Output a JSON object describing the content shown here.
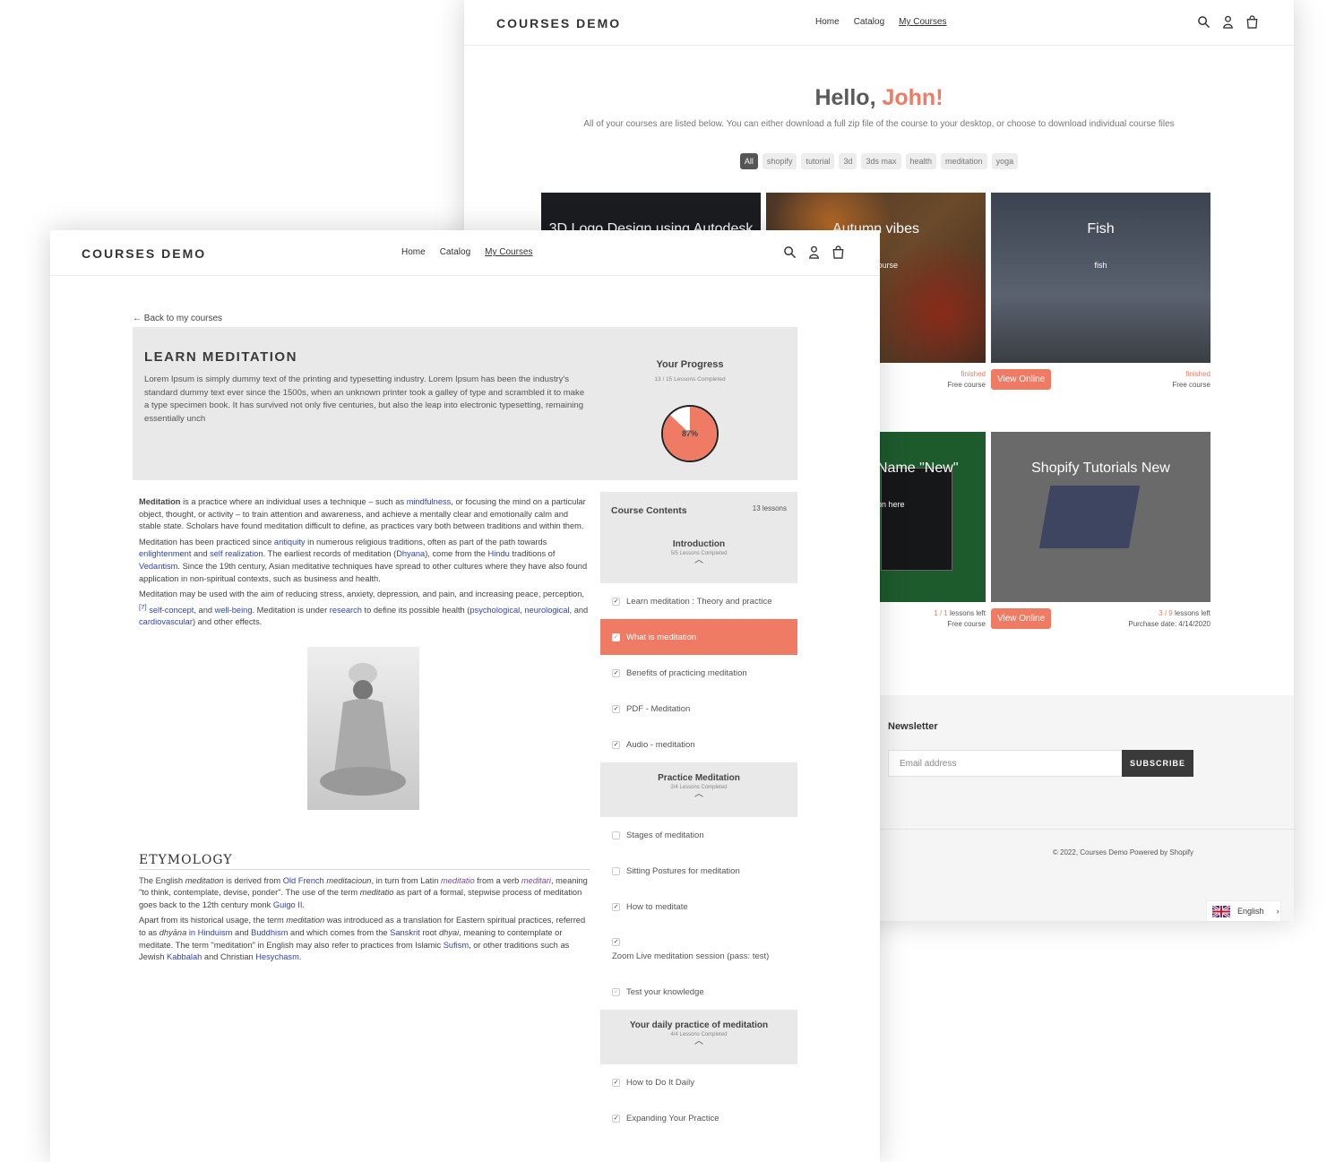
{
  "colors": {
    "accent": "#ef7b64",
    "dark": "#3a3a3a"
  },
  "back": {
    "logo": "COURSES DEMO",
    "nav": [
      "Home",
      "Catalog",
      "My Courses"
    ],
    "active_nav": "My Courses",
    "icons": [
      "search-icon",
      "account-icon",
      "cart-icon"
    ],
    "hello": "Hello,",
    "name": "John!",
    "intro": "All of your courses are listed below. You can either download a full zip file of the course to your desktop, or choose to download individual course files",
    "tags": [
      "All",
      "shopify",
      "tutorial",
      "3d",
      "3ds max",
      "health",
      "meditation",
      "yoga"
    ],
    "selected_tag": "All",
    "cards": [
      {
        "title": "3D Logo Design using Autodesk",
        "subtitle": ""
      },
      {
        "title": "Autumn vibes",
        "subtitle": "course",
        "status": "finished",
        "price": "Free course"
      },
      {
        "title": "Fish",
        "subtitle": "fish",
        "status": "finished",
        "price": "Free course",
        "button": "View Online"
      },
      {
        "title": "Name \"New\"",
        "subtitle": "on here",
        "lessons_done": "1 / 1",
        "lessons_label": "lessons left",
        "price": "Free course"
      },
      {
        "title": "Shopify Tutorials New",
        "subtitle": "",
        "lessons_done": "3 / 9",
        "lessons_label": "lessons left",
        "purchase": "Purchase date: 4/14/2020",
        "button": "View Online"
      }
    ],
    "newsletter": {
      "title": "Newsletter",
      "placeholder": "Email address",
      "button": "SUBSCRIBE"
    },
    "copyright": "© 2022, Courses Demo Powered by Shopify",
    "language": "English"
  },
  "front": {
    "logo": "COURSES DEMO",
    "nav": [
      "Home",
      "Catalog",
      "My Courses"
    ],
    "back_link": "Back to my courses",
    "course_title": "LEARN MEDITATION",
    "course_desc": "Lorem Ipsum is simply dummy text of the printing and typesetting industry. Lorem Ipsum has been the industry's standard dummy text ever since the 1500s, when an unknown printer took a galley of type and scrambled it to make a type specimen book. It has survived not only five centuries, but also the leap into electronic typesetting, remaining essentially unch",
    "progress": {
      "title": "Your Progress",
      "subtitle": "13 / 15 Lessons Completed",
      "percent": 87,
      "label": "87%"
    },
    "etymology_title": "ETYMOLOGY",
    "sidebar": {
      "title": "Course Contents",
      "count": "13 lessons",
      "sections": [
        {
          "title": "Introduction",
          "completed": "5/5 Lessons Completed",
          "lessons": [
            {
              "label": "Learn meditation : Theory and practice",
              "done": true
            },
            {
              "label": "What is meditation",
              "done": true,
              "active": true
            },
            {
              "label": "Benefits of practicing meditation",
              "done": true
            },
            {
              "label": "PDF - Meditation",
              "done": true
            },
            {
              "label": "Audio - meditation",
              "done": true
            }
          ]
        },
        {
          "title": "Practice Meditation",
          "completed": "2/4 Lessons Completed",
          "lessons": [
            {
              "label": "Stages of meditation",
              "done": false
            },
            {
              "label": "Sitting Postures for meditation",
              "done": false
            },
            {
              "label": "How to meditate",
              "done": true
            },
            {
              "label": "Zoom Live meditation session (pass: test)",
              "done": true,
              "tall": true
            },
            {
              "label": "Test your knowledge",
              "done": true,
              "dim": true
            }
          ]
        },
        {
          "title": "Your daily practice of meditation",
          "completed": "4/4 Lessons Completed",
          "lessons": [
            {
              "label": "How to Do It Daily",
              "done": true
            },
            {
              "label": "Expanding Your Practice",
              "done": true
            }
          ]
        }
      ]
    }
  }
}
